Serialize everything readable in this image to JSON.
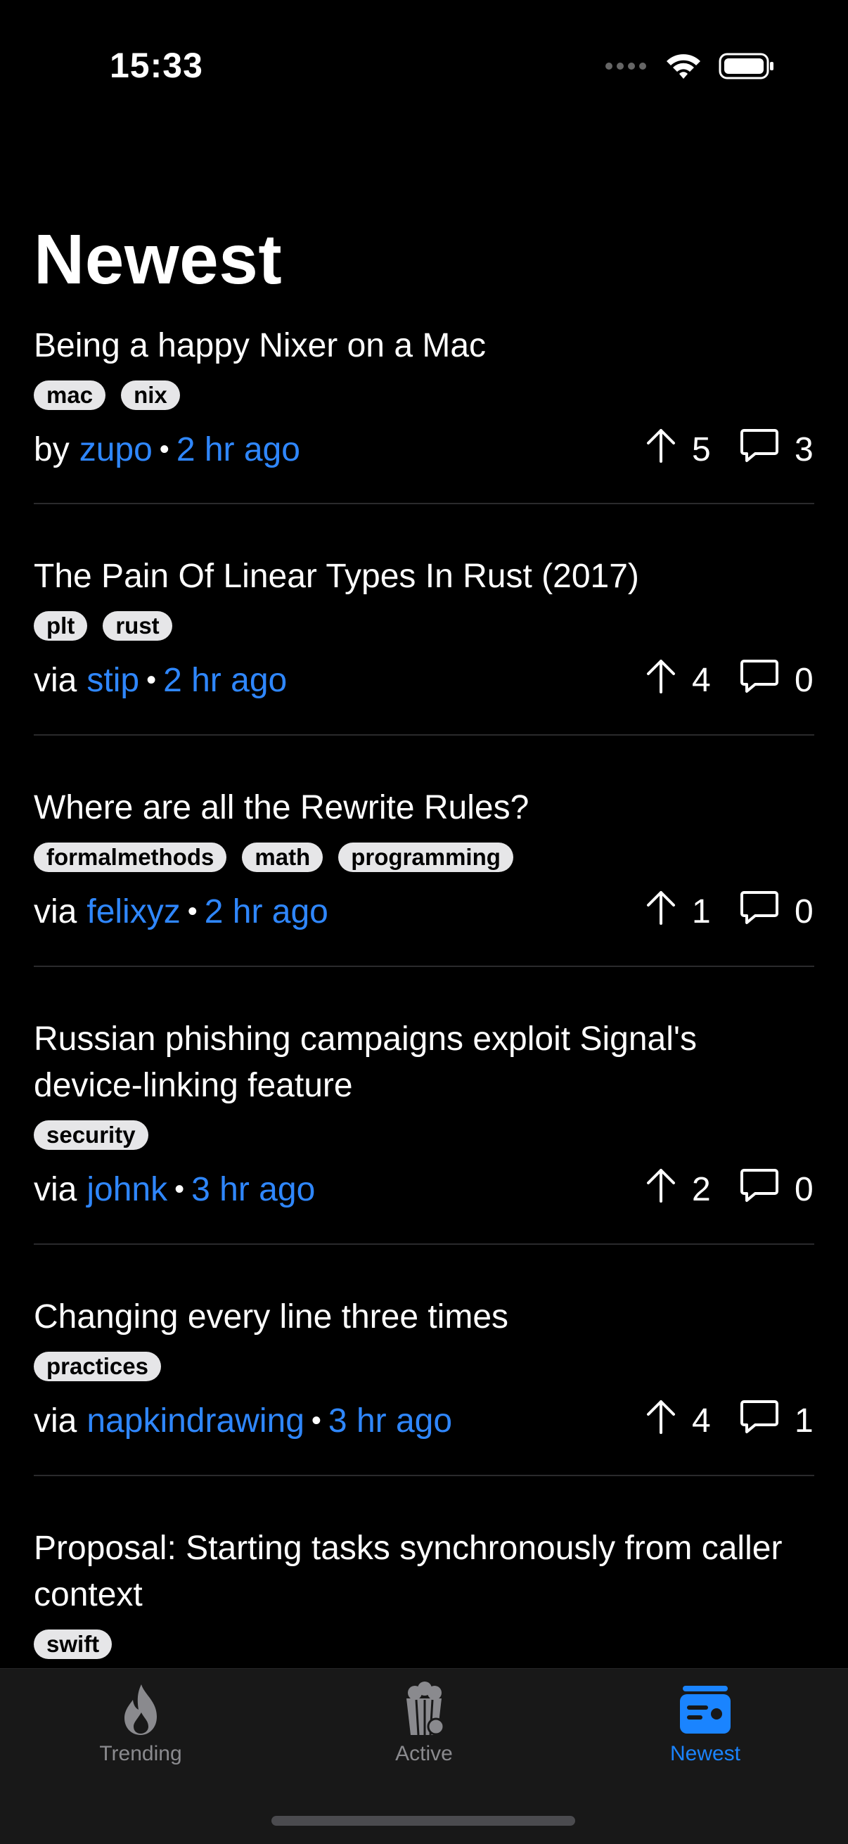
{
  "status_bar": {
    "time": "15:33"
  },
  "page": {
    "title": "Newest"
  },
  "stories": [
    {
      "title": "Being a happy Nixer on a Mac",
      "tags": [
        "mac",
        "nix"
      ],
      "prefix": "by",
      "author": "zupo",
      "time": "2 hr ago",
      "votes": "5",
      "comments": "3"
    },
    {
      "title": "The Pain Of Linear Types In Rust (2017)",
      "tags": [
        "plt",
        "rust"
      ],
      "prefix": "via",
      "author": "stip",
      "time": "2 hr ago",
      "votes": "4",
      "comments": "0"
    },
    {
      "title": "Where are all the Rewrite Rules?",
      "tags": [
        "formalmethods",
        "math",
        "programming"
      ],
      "prefix": "via",
      "author": "felixyz",
      "time": "2 hr ago",
      "votes": "1",
      "comments": "0"
    },
    {
      "title": "Russian phishing campaigns exploit Signal's device-linking feature",
      "tags": [
        "security"
      ],
      "prefix": "via",
      "author": "johnk",
      "time": "3 hr ago",
      "votes": "2",
      "comments": "0"
    },
    {
      "title": "Changing every line three times",
      "tags": [
        "practices"
      ],
      "prefix": "via",
      "author": "napkindrawing",
      "time": "3 hr ago",
      "votes": "4",
      "comments": "1"
    },
    {
      "title": "Proposal: Starting tasks synchronously from caller context",
      "tags": [
        "swift"
      ]
    }
  ],
  "tabbar": {
    "tabs": [
      {
        "label": "Trending",
        "icon": "flame-icon",
        "active": false
      },
      {
        "label": "Active",
        "icon": "popcorn-icon",
        "active": false
      },
      {
        "label": "Newest",
        "icon": "newspaper-icon",
        "active": true
      }
    ]
  },
  "colors": {
    "accent": "#1a84ff",
    "link": "#2f87ff",
    "background": "#000000",
    "tag_bg": "#e6e6e8"
  }
}
